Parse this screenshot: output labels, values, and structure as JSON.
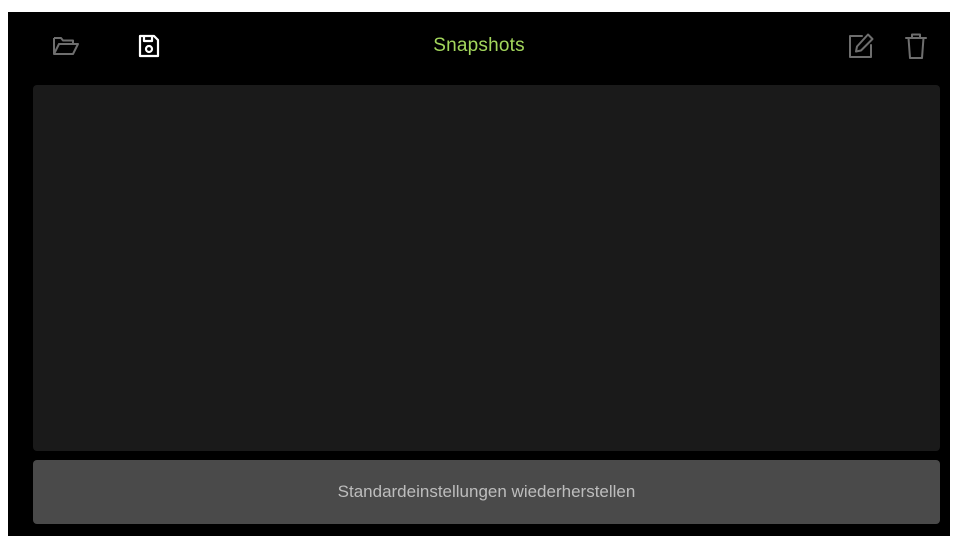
{
  "header": {
    "title": "Snapshots",
    "icons": {
      "open": "folder-open-icon",
      "save": "floppy-disk-icon",
      "edit": "edit-icon",
      "delete": "trash-icon"
    }
  },
  "snapshot_list": {
    "items": []
  },
  "restore_button": {
    "label": "Standardeinstellungen wiederherstellen"
  },
  "colors": {
    "background": "#000000",
    "title": "#a3d65c",
    "icon_dim": "#6e6e6e",
    "icon_active": "#ffffff",
    "panel": "#1a1a1a",
    "button": "#4a4a4a",
    "button_text": "#bdbdbd"
  }
}
